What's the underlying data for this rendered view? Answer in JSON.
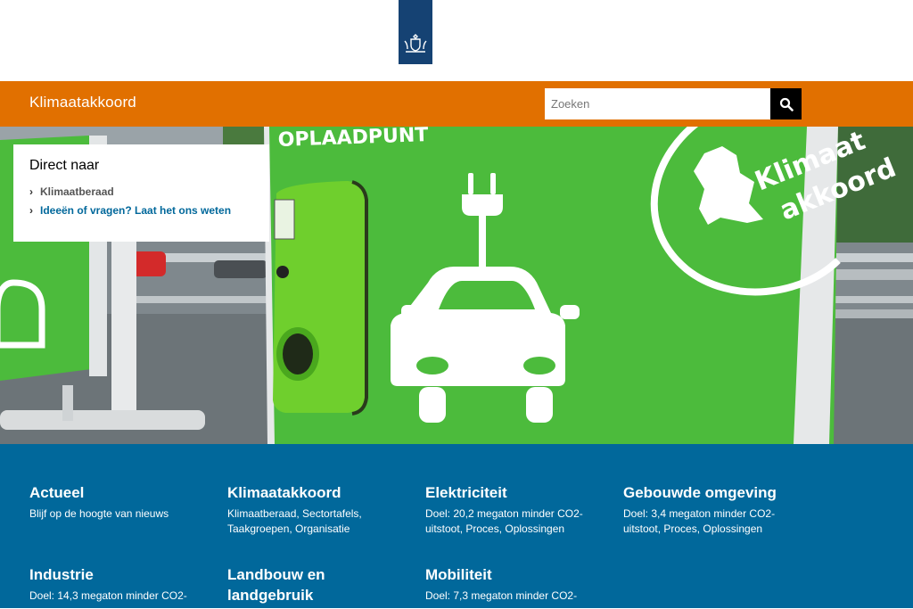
{
  "header": {
    "logo_icon": "royal-coat-of-arms-icon",
    "brand_color": "#154273"
  },
  "nav": {
    "site_title": "Klimaatakkoord",
    "search_placeholder": "Zoeken",
    "search_icon": "search-icon",
    "bar_color": "#e17000"
  },
  "hero": {
    "station_text": "OPLAADPUNT",
    "logo_line1": "Klimaat",
    "logo_line2": "akkoord"
  },
  "direct": {
    "title": "Direct naar",
    "links": [
      {
        "label": "Klimaatberaad"
      },
      {
        "label": "Ideeën of vragen? Laat het ons weten"
      }
    ]
  },
  "tiles": [
    {
      "title": "Actueel",
      "desc": "Blijf op de hoogte van nieuws"
    },
    {
      "title": "Klimaatakkoord",
      "desc": "Klimaatberaad, Sectortafels, Taakgroepen, Organisatie"
    },
    {
      "title": "Elektriciteit",
      "desc": "Doel: 20,2 megaton minder CO2-uitstoot, Proces, Oplossingen"
    },
    {
      "title": "Gebouwde omgeving",
      "desc": "Doel: 3,4 megaton minder CO2-uitstoot, Proces, Oplossingen"
    },
    {
      "title": "Industrie",
      "desc": "Doel: 14,3 megaton minder CO2-"
    },
    {
      "title": "Landbouw en landgebruik",
      "desc": ""
    },
    {
      "title": "Mobiliteit",
      "desc": "Doel: 7,3 megaton minder CO2-"
    }
  ],
  "colors": {
    "accent_blue": "#01689b",
    "hero_green": "#4cbb3c"
  }
}
